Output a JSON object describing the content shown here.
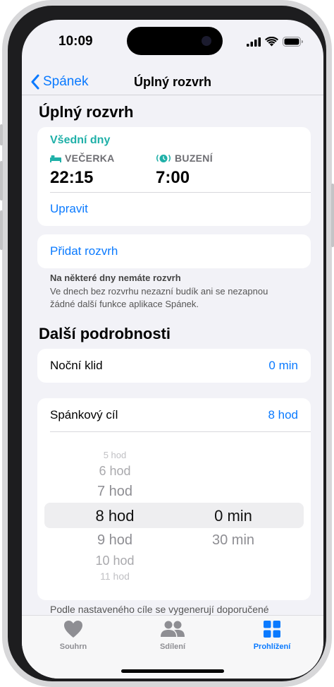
{
  "status": {
    "time": "10:09"
  },
  "nav": {
    "back_label": "Spánek",
    "title": "Úplný rozvrh"
  },
  "schedule": {
    "section_title": "Úplný rozvrh",
    "days_label": "Všední dny",
    "bedtime_label": "VEČERKA",
    "bedtime_value": "22:15",
    "wake_label": "BUZENÍ",
    "wake_value": "7:00",
    "edit_label": "Upravit",
    "add_label": "Přidat rozvrh",
    "note_title": "Na některé dny nemáte rozvrh",
    "note_line1": "Ve dnech bez rozvrhu nezazní budík ani se nezapnou",
    "note_line2": "žádné další funkce aplikace Spánek."
  },
  "details": {
    "section_title": "Další podrobnosti",
    "wind_down_label": "Noční klid",
    "wind_down_value": "0 min",
    "goal_label": "Spánkový cíl",
    "goal_value": "8 hod",
    "picker_hours": [
      "5 hod",
      "6 hod",
      "7 hod",
      "8 hod",
      "9 hod",
      "10 hod",
      "11 hod"
    ],
    "picker_minutes": [
      "0 min",
      "30 min"
    ],
    "footer_note": "Podle nastaveného cíle se vygenerují doporučené"
  },
  "tabs": [
    {
      "label": "Souhrn",
      "active": false
    },
    {
      "label": "Sdílení",
      "active": false
    },
    {
      "label": "Prohlížení",
      "active": true
    }
  ],
  "colors": {
    "accent": "#1fb0a8",
    "link": "#0a7aff",
    "inactive_tab": "#8e8e93"
  }
}
